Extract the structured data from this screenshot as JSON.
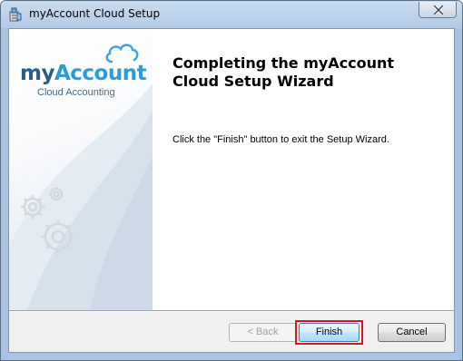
{
  "window": {
    "title": "myAccount Cloud Setup"
  },
  "banner": {
    "logo_my": "my",
    "logo_account": "Account",
    "logo_subtitle": "Cloud Accounting"
  },
  "content": {
    "heading": "Completing the myAccount Cloud Setup Wizard",
    "description": "Click the \"Finish\" button to exit the Setup Wizard."
  },
  "buttons": {
    "back": "< Back",
    "finish": "Finish",
    "cancel": "Cancel"
  },
  "colors": {
    "logo_blue": "#2d9bd4",
    "logo_dark": "#2a5d8a",
    "highlight": "#d9141e"
  }
}
